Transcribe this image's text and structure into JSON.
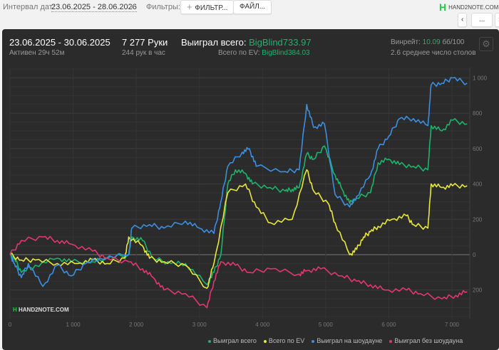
{
  "topbar": {
    "interval_label": "Интервал дат:",
    "interval_value": "23.06.2025 - 28.06.2026",
    "filters_label": "Фильтры:",
    "filter_button": "ФИЛЬТР...",
    "file_button": "ФАЙЛ...",
    "logo": "HAND2NOTE.COM",
    "nav_more": "..."
  },
  "summary": {
    "period": "23.06.2025 - 30.06.2025",
    "active": "Активен 29ч 52м",
    "hands": "7 277 Руки",
    "hands_per_hour": "244 рук в час",
    "won_label": "Выиграл всего:",
    "won_value": "BigBlind733.97",
    "ev_label": "Всего по EV:",
    "ev_value": "BigBlind384.03",
    "winrate_label": "Винрейт:",
    "winrate_value": "10.09",
    "winrate_suffix": "бб/100",
    "tables": "2.6 среднее число столов"
  },
  "watermark": "HAND2NOTE.COM",
  "chart_data": {
    "type": "line",
    "xlabel": "",
    "ylabel": "",
    "xlim": [
      0,
      7300
    ],
    "ylim": [
      -350,
      1050
    ],
    "x_ticks": [
      0,
      1000,
      2000,
      3000,
      4000,
      5000,
      6000,
      7000
    ],
    "x_tick_labels": [
      "0",
      "1 000",
      "2 000",
      "3 000",
      "4 000",
      "5 000",
      "6 000",
      "7 000"
    ],
    "y_ticks": [
      1000,
      800,
      600,
      400,
      200,
      0,
      -200
    ],
    "y_tick_labels": [
      "1 000",
      "800",
      "600",
      "400",
      "200",
      "0",
      "200"
    ],
    "legend_position": "bottom-right",
    "series": [
      {
        "name": "Выиграл всего",
        "color": "#1db36b",
        "points": [
          [
            0,
            0
          ],
          [
            70,
            -20
          ],
          [
            180,
            -100
          ],
          [
            400,
            -60
          ],
          [
            750,
            -20
          ],
          [
            970,
            -40
          ],
          [
            1310,
            -40
          ],
          [
            1540,
            -20
          ],
          [
            1880,
            0
          ],
          [
            1930,
            100
          ],
          [
            2100,
            80
          ],
          [
            2270,
            -20
          ],
          [
            2550,
            -50
          ],
          [
            2780,
            -50
          ],
          [
            3120,
            -170
          ],
          [
            3230,
            -100
          ],
          [
            3340,
            0
          ],
          [
            3450,
            400
          ],
          [
            3570,
            480
          ],
          [
            3730,
            460
          ],
          [
            3840,
            400
          ],
          [
            4120,
            380
          ],
          [
            4360,
            360
          ],
          [
            4470,
            370
          ],
          [
            4580,
            380
          ],
          [
            4700,
            570
          ],
          [
            4810,
            540
          ],
          [
            4980,
            615
          ],
          [
            5150,
            450
          ],
          [
            5260,
            370
          ],
          [
            5380,
            290
          ],
          [
            5490,
            320
          ],
          [
            5710,
            350
          ],
          [
            5830,
            520
          ],
          [
            6000,
            540
          ],
          [
            6170,
            510
          ],
          [
            6390,
            500
          ],
          [
            6620,
            480
          ],
          [
            6670,
            730
          ],
          [
            6840,
            700
          ],
          [
            7010,
            760
          ],
          [
            7240,
            740
          ]
        ]
      },
      {
        "name": "Всего по EV",
        "color": "#e8e83a",
        "points": [
          [
            0,
            0
          ],
          [
            180,
            -30
          ],
          [
            400,
            -30
          ],
          [
            750,
            -50
          ],
          [
            1080,
            -50
          ],
          [
            1310,
            -30
          ],
          [
            1540,
            -50
          ],
          [
            1820,
            -20
          ],
          [
            1880,
            100
          ],
          [
            2100,
            50
          ],
          [
            2210,
            -20
          ],
          [
            2440,
            -40
          ],
          [
            2780,
            -60
          ],
          [
            3120,
            -190
          ],
          [
            3230,
            -50
          ],
          [
            3450,
            350
          ],
          [
            3730,
            400
          ],
          [
            3900,
            270
          ],
          [
            4130,
            180
          ],
          [
            4470,
            200
          ],
          [
            4700,
            480
          ],
          [
            4810,
            360
          ],
          [
            5040,
            290
          ],
          [
            5150,
            180
          ],
          [
            5380,
            0
          ],
          [
            5490,
            30
          ],
          [
            5600,
            100
          ],
          [
            5710,
            130
          ],
          [
            5830,
            160
          ],
          [
            6050,
            200
          ],
          [
            6280,
            220
          ],
          [
            6390,
            170
          ],
          [
            6620,
            150
          ],
          [
            6670,
            400
          ],
          [
            6840,
            380
          ],
          [
            7010,
            390
          ],
          [
            7240,
            390
          ]
        ]
      },
      {
        "name": "Выиграл на шоудауне",
        "color": "#3b8fe0",
        "points": [
          [
            0,
            0
          ],
          [
            70,
            -50
          ],
          [
            180,
            -130
          ],
          [
            290,
            -50
          ],
          [
            520,
            -180
          ],
          [
            750,
            -60
          ],
          [
            970,
            -120
          ],
          [
            1200,
            -50
          ],
          [
            1420,
            -20
          ],
          [
            1880,
            0
          ],
          [
            1930,
            150
          ],
          [
            2210,
            170
          ],
          [
            2440,
            150
          ],
          [
            2780,
            190
          ],
          [
            3000,
            150
          ],
          [
            3230,
            120
          ],
          [
            3340,
            300
          ],
          [
            3450,
            500
          ],
          [
            3680,
            580
          ],
          [
            3790,
            600
          ],
          [
            3900,
            500
          ],
          [
            4360,
            470
          ],
          [
            4580,
            480
          ],
          [
            4700,
            850
          ],
          [
            4810,
            720
          ],
          [
            4980,
            740
          ],
          [
            5150,
            340
          ],
          [
            5380,
            270
          ],
          [
            5490,
            330
          ],
          [
            5710,
            450
          ],
          [
            5830,
            600
          ],
          [
            6000,
            670
          ],
          [
            6170,
            770
          ],
          [
            6390,
            770
          ],
          [
            6620,
            730
          ],
          [
            6670,
            960
          ],
          [
            6840,
            970
          ],
          [
            7010,
            1000
          ],
          [
            7240,
            970
          ]
        ]
      },
      {
        "name": "Выиграл без шоудауна",
        "color": "#e0386e",
        "points": [
          [
            0,
            0
          ],
          [
            180,
            80
          ],
          [
            520,
            100
          ],
          [
            750,
            80
          ],
          [
            970,
            60
          ],
          [
            1310,
            20
          ],
          [
            1540,
            -20
          ],
          [
            1880,
            -40
          ],
          [
            2100,
            -80
          ],
          [
            2270,
            -130
          ],
          [
            2440,
            -200
          ],
          [
            2780,
            -220
          ],
          [
            3120,
            -300
          ],
          [
            3230,
            -150
          ],
          [
            3340,
            -40
          ],
          [
            3570,
            -60
          ],
          [
            3790,
            -100
          ],
          [
            4130,
            -80
          ],
          [
            4580,
            -110
          ],
          [
            4700,
            -90
          ],
          [
            4920,
            -80
          ],
          [
            5260,
            -120
          ],
          [
            5490,
            -150
          ],
          [
            5710,
            -170
          ],
          [
            5940,
            -200
          ],
          [
            6280,
            -200
          ],
          [
            6500,
            -220
          ],
          [
            6840,
            -250
          ],
          [
            7060,
            -230
          ],
          [
            7240,
            -210
          ]
        ]
      }
    ]
  }
}
